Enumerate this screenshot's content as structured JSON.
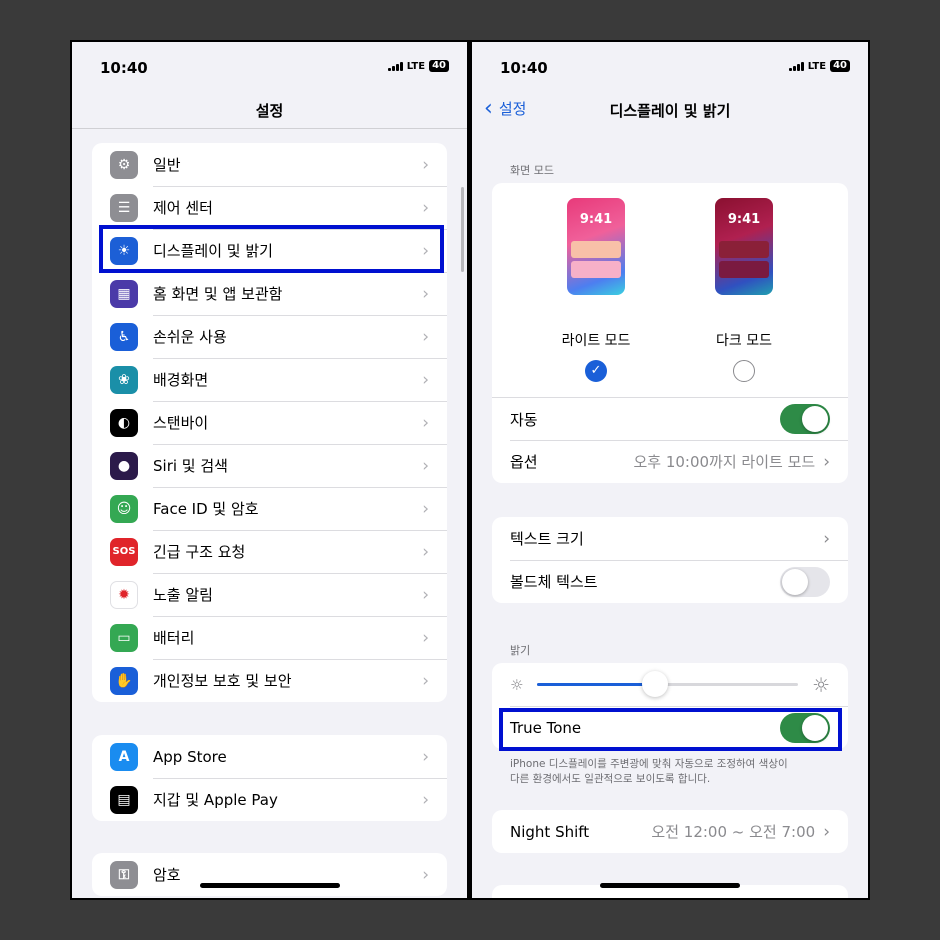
{
  "left": {
    "status": {
      "time": "10:40",
      "network": "LTE",
      "battery": "40"
    },
    "title": "설정",
    "groups": [
      [
        {
          "label": "일반",
          "icon": "gear-icon",
          "color": "#8e8e93",
          "glyph": "⚙"
        },
        {
          "label": "제어 센터",
          "icon": "toggles-icon",
          "color": "#8e8e93",
          "glyph": "☰"
        },
        {
          "label": "디스플레이 및 밝기",
          "icon": "sun-icon",
          "color": "#1c5fd6",
          "glyph": "☀"
        },
        {
          "label": "홈 화면 및 앱 보관함",
          "icon": "app-grid-icon",
          "color": "#4b3aa8",
          "glyph": "▦"
        },
        {
          "label": "손쉬운 사용",
          "icon": "accessibility-icon",
          "color": "#1a5fd8",
          "glyph": "♿"
        },
        {
          "label": "배경화면",
          "icon": "flower-icon",
          "color": "#1a8fa8",
          "glyph": "❀"
        },
        {
          "label": "스탠바이",
          "icon": "standby-icon",
          "color": "#000000",
          "glyph": "◐"
        },
        {
          "label": "Siri 및 검색",
          "icon": "siri-icon",
          "color": "#2b1a4a",
          "glyph": "●"
        },
        {
          "label": "Face ID 및 암호",
          "icon": "face-id-icon",
          "color": "#34a853",
          "glyph": "☺"
        },
        {
          "label": "긴급 구조 요청",
          "icon": "sos-icon",
          "color": "#e0242a",
          "glyph": "SOS"
        },
        {
          "label": "노출 알림",
          "icon": "exposure-icon",
          "color": "#ffffff",
          "glyph": "✹"
        },
        {
          "label": "배터리",
          "icon": "battery-icon",
          "color": "#34a853",
          "glyph": "▭"
        },
        {
          "label": "개인정보 보호 및 보안",
          "icon": "hand-icon",
          "color": "#1a5fd8",
          "glyph": "✋"
        }
      ],
      [
        {
          "label": "App Store",
          "icon": "app-store-icon",
          "color": "#1a8cf0",
          "glyph": "A"
        },
        {
          "label": "지갑 및 Apple Pay",
          "icon": "wallet-icon",
          "color": "#000000",
          "glyph": "▤"
        }
      ],
      [
        {
          "label": "암호",
          "icon": "key-icon",
          "color": "#8e8e93",
          "glyph": "⚿"
        }
      ]
    ]
  },
  "right": {
    "status": {
      "time": "10:40",
      "network": "LTE",
      "battery": "40"
    },
    "back_label": "설정",
    "title": "디스플레이 및 밝기",
    "appearance_header": "화면 모드",
    "preview_time": "9:41",
    "light_label": "라이트 모드",
    "dark_label": "다크 모드",
    "selected": "light",
    "auto_label": "자동",
    "auto_on": true,
    "options_label": "옵션",
    "options_value": "오후 10:00까지 라이트 모드",
    "text_size_label": "텍스트 크기",
    "bold_label": "볼드체 텍스트",
    "bold_on": false,
    "brightness_header": "밝기",
    "brightness": 0.45,
    "true_tone_label": "True Tone",
    "true_tone_on": true,
    "true_tone_footer_1": "iPhone 디스플레이를 주변광에 맞춰 자동으로 조정하여 색상이",
    "true_tone_footer_2": "다른 환경에서도 일관적으로 보이도록 합니다.",
    "night_shift_label": "Night Shift",
    "night_shift_value": "오전 12:00 ~ 오전 7:00"
  },
  "colors": {
    "accent": "#1a5fd8",
    "highlight": "#0010d0",
    "toggle_on": "#2e8b47"
  }
}
